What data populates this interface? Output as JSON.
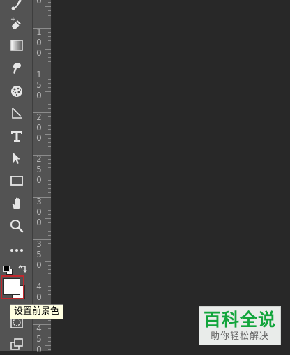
{
  "ruler": {
    "labels": [
      {
        "digits": [
          "0"
        ]
      },
      {
        "digits": [
          "1",
          "0",
          "0"
        ]
      },
      {
        "digits": [
          "1",
          "5",
          "0"
        ]
      },
      {
        "digits": [
          "2",
          "0",
          "0"
        ]
      },
      {
        "digits": [
          "2",
          "5",
          "0"
        ]
      },
      {
        "digits": [
          "3",
          "0",
          "0"
        ]
      },
      {
        "digits": [
          "3",
          "5",
          "0"
        ]
      },
      {
        "digits": [
          "4",
          "0",
          "0"
        ]
      },
      {
        "digits": [
          "4",
          "5",
          "0"
        ]
      }
    ]
  },
  "toolbar": {
    "tools": [
      {
        "name": "brush-tool",
        "icon": "brush-icon"
      },
      {
        "name": "eraser-tool",
        "icon": "eraser-icon"
      },
      {
        "name": "gradient-tool",
        "icon": "gradient-icon"
      },
      {
        "name": "smudge-tool",
        "icon": "smudge-icon"
      },
      {
        "name": "sponge-tool",
        "icon": "sponge-icon"
      },
      {
        "name": "pen-tool",
        "icon": "pen-icon"
      },
      {
        "name": "type-tool",
        "icon": "type-icon"
      },
      {
        "name": "path-selection-tool",
        "icon": "arrow-icon"
      },
      {
        "name": "rectangle-tool",
        "icon": "rectangle-icon"
      },
      {
        "name": "hand-tool",
        "icon": "hand-icon"
      },
      {
        "name": "zoom-tool",
        "icon": "zoom-icon"
      },
      {
        "name": "edit-toolbar",
        "icon": "more-icon"
      }
    ],
    "foreground_color": "#ffffff",
    "background_color": "#ffffff",
    "highlight_color": "#c0282d"
  },
  "tooltip": {
    "text": "设置前景色"
  },
  "watermark": {
    "title": "百科全说",
    "subtitle": "助你轻松解决"
  }
}
